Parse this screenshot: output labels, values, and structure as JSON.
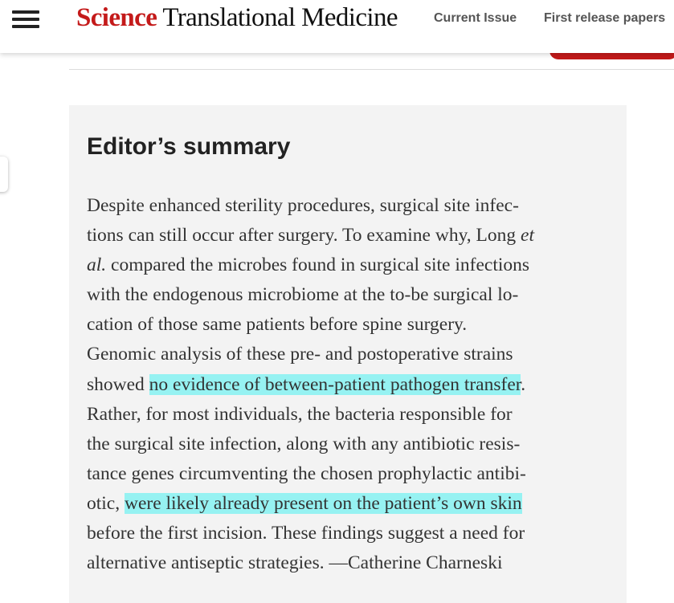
{
  "header": {
    "logo_brand": "Science",
    "logo_journal": "Translational Medicine",
    "nav": {
      "current_issue": "Current Issue",
      "first_release": "First release papers"
    }
  },
  "summary": {
    "title": "Editor’s summary",
    "lines": [
      {
        "a": "Despite enhanced sterility procedures, surgical site infec-"
      },
      {
        "a": "tions can still occur after surgery. To examine why, Long ",
        "em": "et"
      },
      {
        "em": "al.",
        "a": " compared the microbes found in surgical site infections"
      },
      {
        "a": "with the endogenous microbiome at the to-be surgical lo-"
      },
      {
        "a": "cation of those same patients before spine surgery."
      },
      {
        "a": "Genomic analysis of these pre- and postoperative strains"
      },
      {
        "a": "showed ",
        "hl": "no evidence of between-patient pathogen transfer",
        "b": "."
      },
      {
        "a": "Rather, for most individuals, the bacteria responsible for"
      },
      {
        "a": "the surgical site infection, along with any antibiotic resis-"
      },
      {
        "a": "tance genes circumventing the chosen prophylactic antibi-"
      },
      {
        "a": "otic, ",
        "hl": "were likely already present on the patient’s own skin"
      },
      {
        "a": "before the first incision. These findings suggest a need for"
      },
      {
        "a": "alternative antiseptic strategies. —Catherine Charneski"
      }
    ]
  },
  "colors": {
    "brand_red": "#c41a1a",
    "highlight": "#96f2f2",
    "summary_bg": "#f3f3f3"
  },
  "icons": {
    "menu": "hamburger-menu-icon"
  }
}
